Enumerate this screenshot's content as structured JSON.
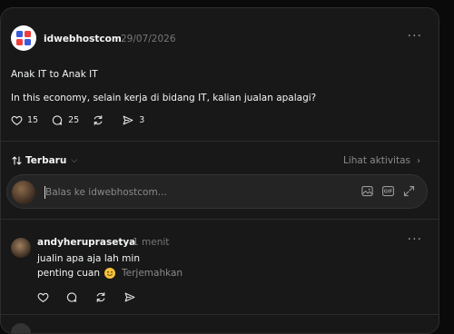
{
  "post": {
    "author": "idwebhostcom",
    "date": "29/07/2026",
    "title": "Anak IT to Anak IT",
    "body": "In this economy, selain kerja di bidang IT, kalian jualan apalagi?",
    "likes": "15",
    "comments": "25",
    "shares": "3",
    "icons": {
      "like": "heart-icon",
      "comment": "comment-icon",
      "repost": "repost-icon",
      "share": "send-icon",
      "more": "more-icon"
    }
  },
  "sort": {
    "label": "Terbaru",
    "icon": "sort-icon"
  },
  "activity": {
    "label": "Lihat aktivitas"
  },
  "reply": {
    "placeholder": "Balas ke idwebhostcom...",
    "icons": [
      "image-icon",
      "gif-icon",
      "expand-icon"
    ]
  },
  "comment": {
    "author": "andyheruprasetya",
    "time": "1 menit",
    "line1": "jualin apa aja lah min",
    "line2": "penting cuan",
    "translate": "Terjemahkan"
  },
  "colors": {
    "background": "#181818",
    "border": "#2d2d2d",
    "text": "#f3f5f7",
    "muted": "#777777"
  }
}
